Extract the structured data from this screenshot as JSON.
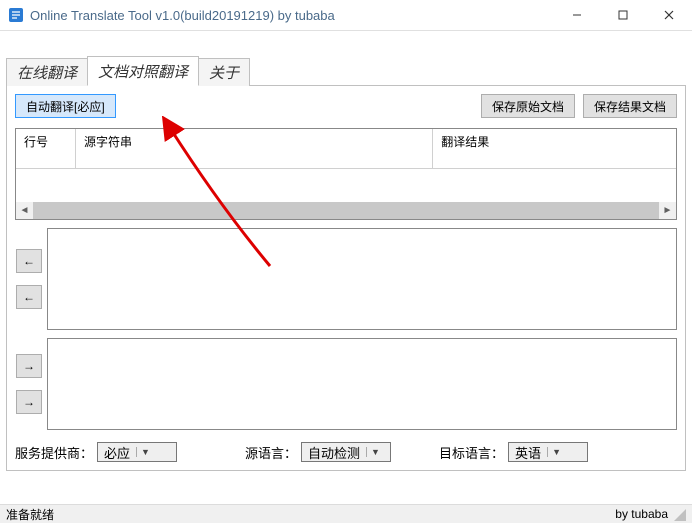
{
  "window": {
    "title": "Online Translate Tool v1.0(build20191219) by tubaba"
  },
  "tabs": {
    "t0": "在线翻译",
    "t1": "文档对照翻译",
    "t2": "关于"
  },
  "buttons": {
    "auto_translate": "自动翻译[必应]",
    "save_source": "保存原始文档",
    "save_result": "保存结果文档"
  },
  "table": {
    "col0": "行号",
    "col1": "源字符串",
    "col2": "翻译结果"
  },
  "config": {
    "provider_label": "服务提供商：",
    "provider_value": "必应",
    "source_lang_label": "源语言：",
    "source_lang_value": "自动检测",
    "target_lang_label": "目标语言：",
    "target_lang_value": "英语"
  },
  "status": {
    "ready": "准备就绪",
    "by": "by tubaba"
  }
}
